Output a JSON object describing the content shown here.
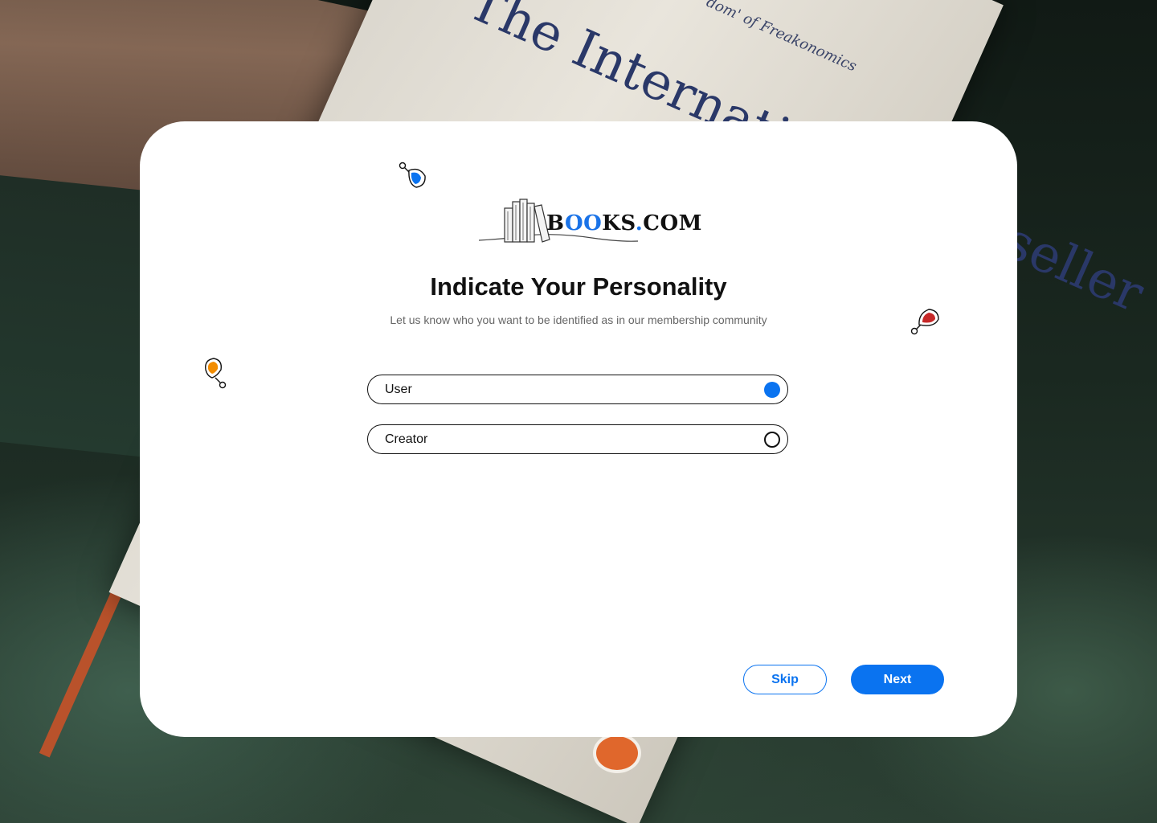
{
  "background": {
    "book_title": "The International Bestseller",
    "book_subtitle": "'dom' of Freakonomics"
  },
  "brand": {
    "name_prefix": "B",
    "name_oo": "OO",
    "name_suffix": "KS",
    "name_dot": ".",
    "name_tld": "COM"
  },
  "page": {
    "title": "Indicate Your Personality",
    "subtitle": "Let us know who you want to be identified as in our membership community"
  },
  "options": [
    {
      "label": "User",
      "selected": true
    },
    {
      "label": "Creator",
      "selected": false
    }
  ],
  "actions": {
    "skip_label": "Skip",
    "next_label": "Next"
  },
  "colors": {
    "accent": "#0A73F0",
    "pin_blue": "#0A73F0",
    "pin_red": "#C62828",
    "pin_orange": "#F28C00"
  },
  "icons": [
    "books-logo-icon",
    "blue-pin-icon",
    "red-pin-icon",
    "orange-pin-icon",
    "radio-selected-icon",
    "radio-unselected-icon"
  ]
}
